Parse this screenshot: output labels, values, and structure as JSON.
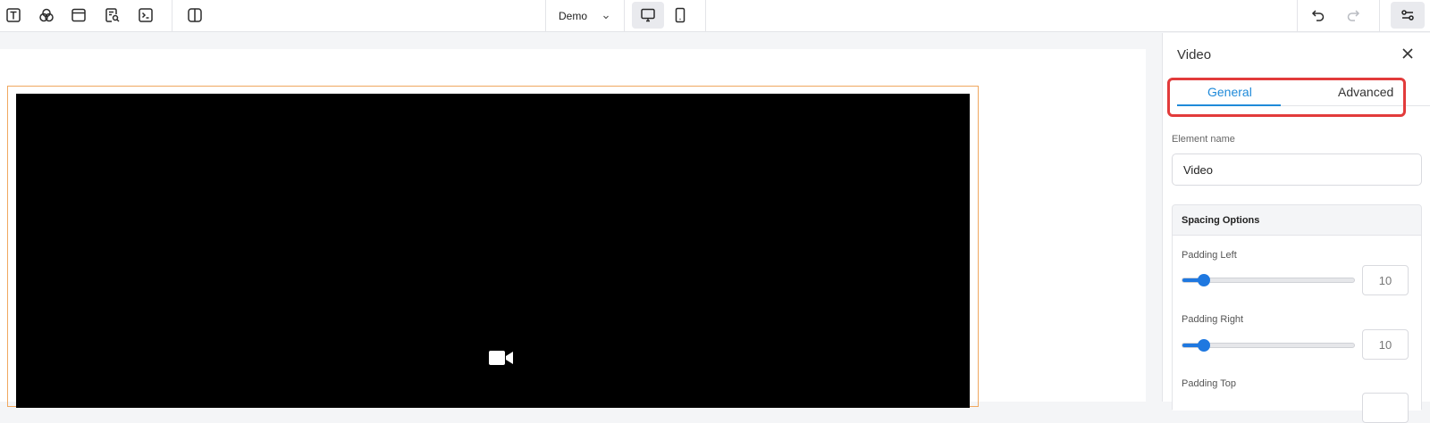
{
  "toolbar": {
    "icons": [
      "text-icon",
      "layers-icon",
      "window-icon",
      "search-document-icon",
      "terminal-icon",
      "split-view-icon"
    ],
    "project_select": "Demo",
    "devices": [
      "desktop-icon",
      "mobile-icon"
    ],
    "active_device": "desktop"
  },
  "panel": {
    "title": "Video",
    "tabs": [
      {
        "label": "General",
        "active": true
      },
      {
        "label": "Advanced",
        "active": false
      }
    ],
    "element_name_label": "Element name",
    "element_name_value": "Video",
    "spacing": {
      "header": "Spacing Options",
      "options": [
        {
          "label": "Padding Left",
          "value": "10"
        },
        {
          "label": "Padding Right",
          "value": "10"
        },
        {
          "label": "Padding Top",
          "value": ""
        }
      ]
    }
  },
  "colors": {
    "accent": "#1f8ad9",
    "slider": "#1f78e0",
    "highlight": "#e23b3b",
    "frame": "#f0a860"
  }
}
